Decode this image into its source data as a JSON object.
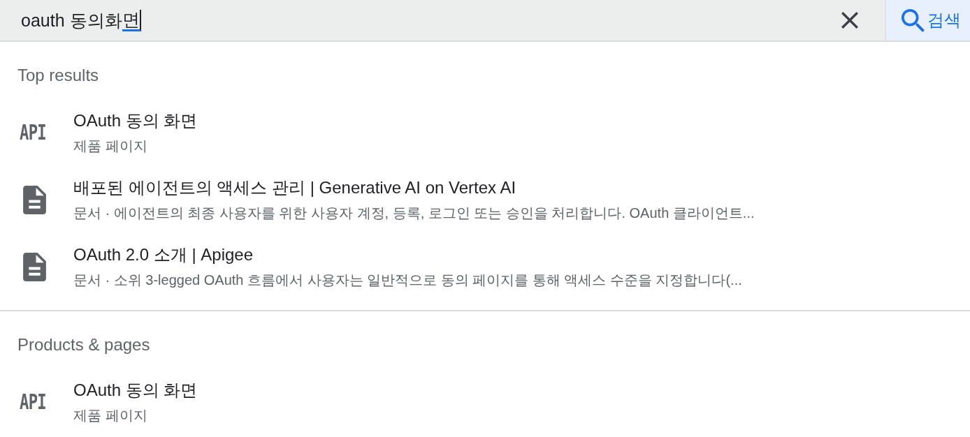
{
  "search_bar": {
    "query": {
      "value": "oauth 동의화면",
      "composing": true
    },
    "search_button": {
      "label": "검색"
    }
  },
  "sections": [
    {
      "heading": "Top results",
      "items": [
        {
          "kind": "product",
          "icon_label": "API",
          "title": "OAuth 동의 화면",
          "subtitle": "제품 페이지"
        },
        {
          "kind": "document",
          "title": "배포된 에이전트의 액세스 관리 | Generative AI on Vertex AI",
          "subtitle": "문서 · 에이전트의 최종 사용자를 위한 사용자 계정, 등록, 로그인 또는 승인을 처리합니다. OAuth 클라이언트..."
        },
        {
          "kind": "document",
          "title": "OAuth 2.0 소개 | Apigee",
          "subtitle": "문서 · 소위 3-legged OAuth 흐름에서 사용자는 일반적으로 동의 페이지를 통해 액세스 수준을 지정합니다(..."
        }
      ]
    },
    {
      "heading": "Products & pages",
      "items": [
        {
          "kind": "product",
          "icon_label": "API",
          "title": "OAuth 동의 화면",
          "subtitle": "제품 페이지"
        }
      ]
    }
  ]
}
